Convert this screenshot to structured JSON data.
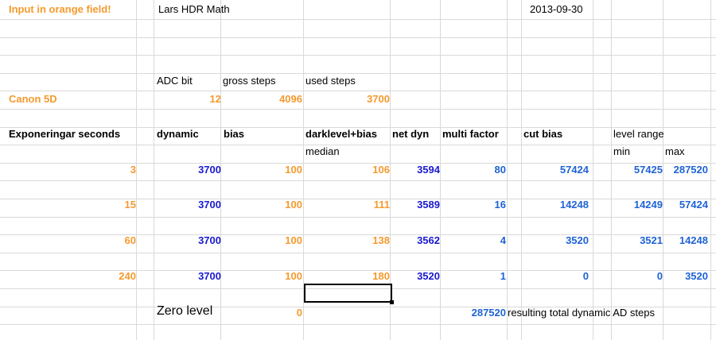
{
  "header": {
    "note": "Input in orange field!",
    "title": "Lars HDR Math",
    "date": "2013-09-30"
  },
  "adc": {
    "labels": {
      "adc_bit": "ADC bit",
      "gross_steps": "gross steps",
      "used_steps": "used steps"
    },
    "camera": "Canon 5D",
    "adc_bit": "12",
    "gross_steps": "4096",
    "used_steps": "3700"
  },
  "table": {
    "headers": {
      "exposures": "Exponeringar seconds",
      "dynamic": "dynamic",
      "bias": "bias",
      "darklevel": "darklevel+bias",
      "net_dyn": "net dyn",
      "multi_factor": "multi factor",
      "cut_bias": "cut bias",
      "level_range": "level range",
      "median": "median",
      "min": "min",
      "max": "max"
    },
    "rows": [
      {
        "exposure": "3",
        "dynamic": "3700",
        "bias": "100",
        "darklevel": "106",
        "net_dyn": "3594",
        "multi": "80",
        "cut_bias": "57424",
        "min": "57425",
        "max": "287520"
      },
      {
        "exposure": "15",
        "dynamic": "3700",
        "bias": "100",
        "darklevel": "111",
        "net_dyn": "3589",
        "multi": "16",
        "cut_bias": "14248",
        "min": "14249",
        "max": "57424"
      },
      {
        "exposure": "60",
        "dynamic": "3700",
        "bias": "100",
        "darklevel": "138",
        "net_dyn": "3562",
        "multi": "4",
        "cut_bias": "3520",
        "min": "3521",
        "max": "14248"
      },
      {
        "exposure": "240",
        "dynamic": "3700",
        "bias": "100",
        "darklevel": "180",
        "net_dyn": "3520",
        "multi": "1",
        "cut_bias": "0",
        "min": "0",
        "max": "3520"
      }
    ]
  },
  "footer": {
    "zero_label": "Zero level",
    "zero_value": "0",
    "total_value": "287520",
    "total_label": "resulting total dynamic AD steps"
  },
  "colors": {
    "input_orange": "#f59a2e",
    "value_blue": "#1a1ad0",
    "result_blue": "#1f63d6",
    "gridline": "#d9d9d9"
  }
}
